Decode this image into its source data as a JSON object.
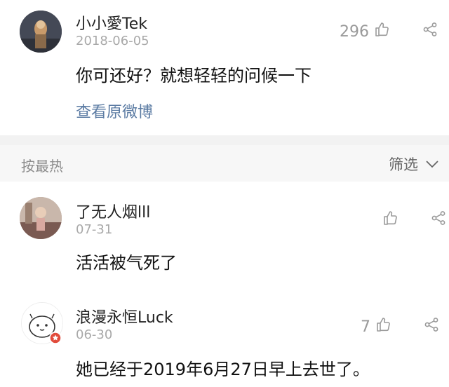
{
  "post": {
    "username": "小小愛Tek",
    "date": "2018-06-05",
    "like_count": "296",
    "text": "你可还好？就想轻轻的问候一下",
    "view_original": "查看原微博"
  },
  "sortbar": {
    "sort_label": "按最热",
    "filter_label": "筛选"
  },
  "comments": [
    {
      "username": "了无人烟lll",
      "date": "07-31",
      "like_count": "",
      "text": "活活被气死了"
    },
    {
      "username": "浪漫永恒Luck",
      "date": "06-30",
      "like_count": "7",
      "text": "她已经于2019年6月27日早上去世了。"
    }
  ],
  "icons": {
    "like": "thumbs-up-icon",
    "share": "share-icon",
    "chevron": "chevron-down-icon",
    "badge": "verified-badge-icon"
  },
  "colors": {
    "link": "#5b7ba3",
    "muted": "#a9a9a9",
    "badge": "#e14b3b"
  }
}
